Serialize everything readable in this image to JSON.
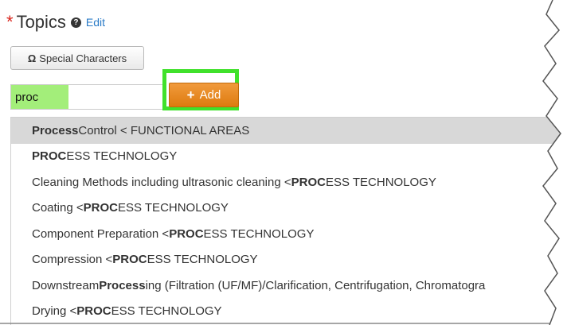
{
  "header": {
    "required_marker": "*",
    "title": "Topics",
    "help_icon": "question-circle-icon",
    "edit_label": "Edit"
  },
  "special_characters": {
    "symbol": "Ω",
    "label": "Special Characters"
  },
  "search": {
    "value": "proc"
  },
  "add_button": {
    "symbol": "+",
    "label": "Add"
  },
  "colors": {
    "highlight_border": "#40e12b",
    "input_match": "#a3ee7a",
    "add_button": "#e8891f"
  },
  "results": [
    {
      "match": "Process",
      "rest": " Control < FUNCTIONAL AREAS",
      "highlighted": true
    },
    {
      "match": "PROC",
      "rest": "ESS TECHNOLOGY"
    },
    {
      "pre": "Cleaning Methods including ultrasonic cleaning < ",
      "match": "PROC",
      "rest": "ESS TECHNOLOGY"
    },
    {
      "pre": "Coating < ",
      "match": "PROC",
      "rest": "ESS TECHNOLOGY"
    },
    {
      "pre": "Component Preparation < ",
      "match": "PROC",
      "rest": "ESS TECHNOLOGY"
    },
    {
      "pre": "Compression < ",
      "match": "PROC",
      "rest": "ESS TECHNOLOGY"
    },
    {
      "pre": "Downstream ",
      "match": "Process",
      "rest": "ing (Filtration (UF/MF)/Clarification, Centrifugation, Chromatogra"
    },
    {
      "pre": "Drying < ",
      "match": "PROC",
      "rest": "ESS TECHNOLOGY"
    }
  ]
}
